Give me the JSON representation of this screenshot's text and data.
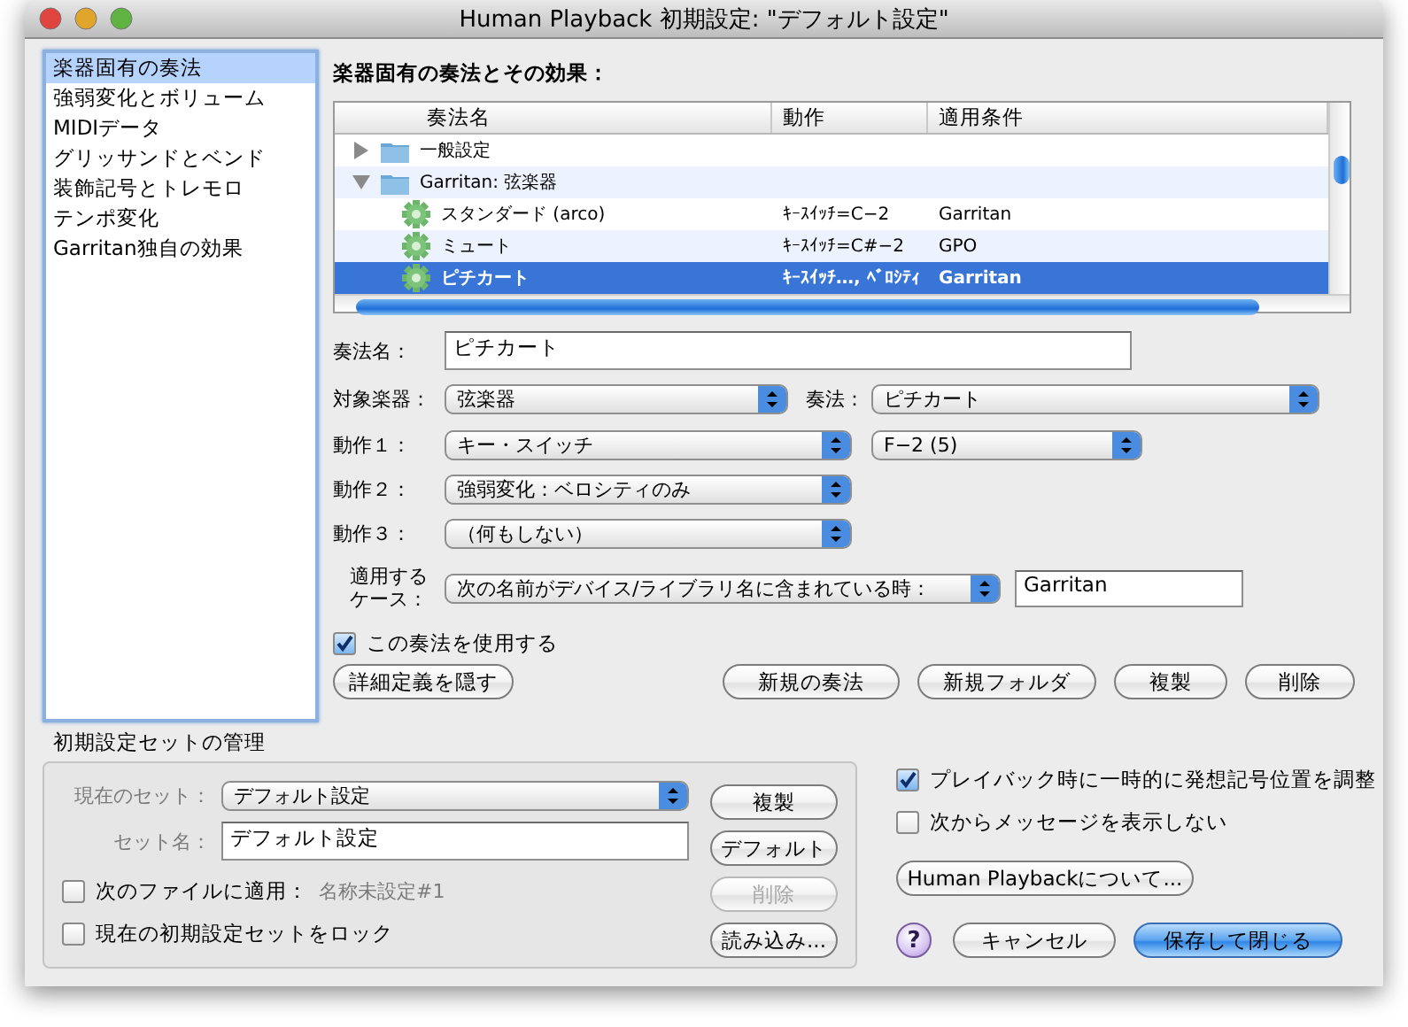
{
  "window": {
    "title": "Human Playback 初期設定: \"デフォルト設定\""
  },
  "sidebar": {
    "items": [
      {
        "label": "楽器固有の奏法",
        "selected": true
      },
      {
        "label": "強弱変化とボリューム",
        "selected": false
      },
      {
        "label": "MIDIデータ",
        "selected": false
      },
      {
        "label": "グリッサンドとベンド",
        "selected": false
      },
      {
        "label": "装飾記号とトレモロ",
        "selected": false
      },
      {
        "label": "テンポ変化",
        "selected": false
      },
      {
        "label": "Garritan独自の効果",
        "selected": false
      }
    ]
  },
  "section_title": "楽器固有の奏法とその効果：",
  "table": {
    "columns": [
      "奏法名",
      "動作",
      "適用条件"
    ],
    "rows": [
      {
        "kind": "folder",
        "name": "一般設定",
        "expanded": false,
        "selected": false
      },
      {
        "kind": "folder",
        "name": "Garritan: 弦楽器",
        "expanded": true,
        "selected": false,
        "children": [
          {
            "kind": "technique",
            "name": "スタンダード (arco)",
            "action": "ｷｰｽｲｯﾁ=C−2",
            "condition": "Garritan",
            "selected": false
          },
          {
            "kind": "technique",
            "name": "ミュート",
            "action": "ｷｰｽｲｯﾁ=C#−2",
            "condition": "GPO",
            "selected": false
          },
          {
            "kind": "technique",
            "name": "ピチカート",
            "action": "ｷｰｽｲｯﾁ…, ﾍﾞﾛｼﾃｨ",
            "condition": "Garritan",
            "selected": true
          }
        ]
      }
    ]
  },
  "form": {
    "name": {
      "label": "奏法名：",
      "value": "ピチカート"
    },
    "target": {
      "label": "対象楽器：",
      "value": "弦楽器"
    },
    "technique": {
      "label": "奏法：",
      "value": "ピチカート"
    },
    "actions": [
      {
        "label": "動作１：",
        "value": "キー・スイッチ",
        "extra": "F−2 (5)"
      },
      {
        "label": "動作２：",
        "value": "強弱変化：ベロシティのみ"
      },
      {
        "label": "動作３：",
        "value": "（何もしない）"
      }
    ],
    "case": {
      "label_lines": [
        "適用する",
        "ケース："
      ],
      "value": "次の名前がデバイス/ライブラリ名に含まれている時：",
      "text": "Garritan"
    },
    "use": {
      "label": "この奏法を使用する",
      "checked": true
    }
  },
  "left_button": "詳細定義を隠す",
  "buttons": [
    "新規の奏法",
    "新規フォルダ",
    "複製",
    "削除"
  ],
  "presets": {
    "title": "初期設定セットの管理",
    "current_label": "現在のセット：",
    "current_value": "デフォルト設定",
    "name_label": "セット名：",
    "name_value": "デフォルト設定",
    "apply": {
      "label": "次のファイルに適用：",
      "checked": false,
      "file": "名称未設定#1"
    },
    "lock": {
      "label": "現在の初期設定セットをロック",
      "checked": false
    },
    "buttons": [
      {
        "label": "複製",
        "disabled": false
      },
      {
        "label": "デフォルト",
        "disabled": false
      },
      {
        "label": "削除",
        "disabled": true
      },
      {
        "label": "読み込み...",
        "disabled": false
      }
    ]
  },
  "options": [
    {
      "label": "プレイバック時に一時的に発想記号位置を調整",
      "checked": true
    },
    {
      "label": "次からメッセージを表示しない",
      "checked": false
    }
  ],
  "about_button": "Human Playbackについて...",
  "help": "?",
  "cancel": "キャンセル",
  "save": "保存して閉じる"
}
